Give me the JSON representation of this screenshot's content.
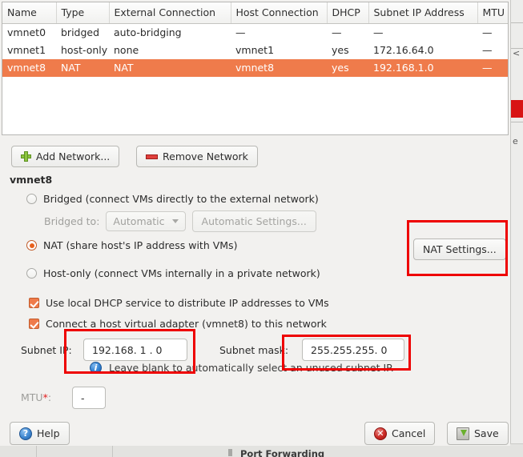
{
  "table": {
    "columns": [
      "Name",
      "Type",
      "External Connection",
      "Host Connection",
      "DHCP",
      "Subnet IP Address",
      "MTU"
    ],
    "rows": [
      {
        "name": "vmnet0",
        "type": "bridged",
        "external_connection": "auto-bridging",
        "host_connection": "—",
        "dhcp": "—",
        "subnet_ip_address": "—",
        "mtu": "—",
        "selected": false
      },
      {
        "name": "vmnet1",
        "type": "host-only",
        "external_connection": "none",
        "host_connection": "vmnet1",
        "dhcp": "yes",
        "subnet_ip_address": "172.16.64.0",
        "mtu": "—",
        "selected": false
      },
      {
        "name": "vmnet8",
        "type": "NAT",
        "external_connection": "NAT",
        "host_connection": "vmnet8",
        "dhcp": "yes",
        "subnet_ip_address": "192.168.1.0",
        "mtu": "—",
        "selected": true
      }
    ]
  },
  "toolbar": {
    "add_network_label": "Add Network...",
    "remove_network_label": "Remove Network",
    "add_icon": "plus-icon",
    "remove_icon": "minus-icon"
  },
  "section": {
    "title": "vmnet8"
  },
  "options": {
    "bridged_label": "Bridged (connect VMs directly to the external network)",
    "bridged_selected": false,
    "bridged_to_label": "Bridged to:",
    "bridged_to_value": "Automatic",
    "automatic_settings_label": "Automatic Settings...",
    "nat_label": "NAT (share host's IP address with VMs)",
    "nat_selected": true,
    "nat_settings_label": "NAT Settings...",
    "hostonly_label": "Host-only (connect VMs internally in a private network)",
    "hostonly_selected": false
  },
  "checkboxes": {
    "dhcp_label": "Use local DHCP service to distribute IP addresses to VMs",
    "dhcp_checked": true,
    "adapter_label": "Connect a host virtual adapter (vmnet8) to this network",
    "adapter_checked": true
  },
  "fields": {
    "subnet_ip_label": "Subnet IP:",
    "subnet_ip_value": "192.168. 1 . 0",
    "subnet_mask_label": "Subnet mask:",
    "subnet_mask_value": "255.255.255. 0",
    "info_text": "Leave blank to automatically select an unused subnet IP.",
    "info_icon": "info-icon",
    "mtu_label": "MTU",
    "mtu_required_marker": "*",
    "mtu_label_suffix": ":",
    "mtu_value": "-"
  },
  "footer": {
    "help_label": "Help",
    "cancel_label": "Cancel",
    "save_label": "Save",
    "help_icon": "question-mark-icon",
    "cancel_icon": "red-circle-x-icon",
    "save_icon": "save-disk-icon"
  },
  "background": {
    "port_forwarding_label": "Port Forwarding"
  },
  "colors": {
    "selection_orange": "#ef7b4b",
    "annotation_red": "#ee0000",
    "required_red": "#e01b1b",
    "accent_green": "#8cc63f"
  }
}
